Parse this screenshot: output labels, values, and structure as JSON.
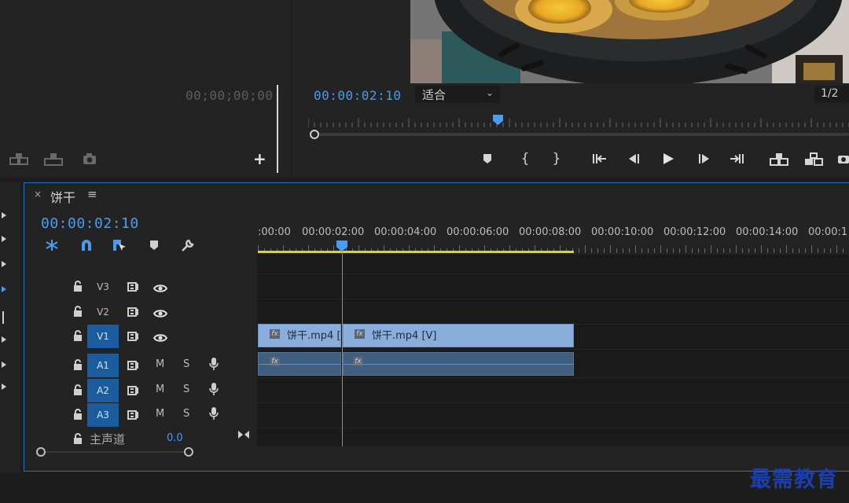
{
  "source_monitor": {
    "timecode": "00;00;00;00",
    "add_icon": "plus-icon"
  },
  "program_monitor": {
    "timecode": "00:00:02:10",
    "zoom": "适合",
    "quality": "1/2",
    "controls": [
      "add-marker-icon",
      "mark-in-icon",
      "mark-out-icon",
      "go-to-in-icon",
      "step-back-icon",
      "play-icon",
      "step-forward-icon",
      "go-to-out-icon",
      "lift-icon",
      "extract-icon",
      "export-frame-icon"
    ]
  },
  "sequence": {
    "close": "×",
    "name": "饼干",
    "menu": "≡",
    "timecode": "00:00:02:10",
    "ruler_labels": [
      ":00:00",
      "00:00:02:00",
      "00:00:04:00",
      "00:00:06:00",
      "00:00:08:00",
      "00:00:10:00",
      "00:00:12:00",
      "00:00:14:00",
      "00:00:1"
    ]
  },
  "tracks": {
    "video": [
      {
        "label": "V3",
        "active": false
      },
      {
        "label": "V2",
        "active": false
      },
      {
        "label": "V1",
        "active": true
      }
    ],
    "audio": [
      {
        "label": "A1",
        "mute": "M",
        "solo": "S"
      },
      {
        "label": "A2",
        "mute": "M",
        "solo": "S"
      },
      {
        "label": "A3",
        "mute": "M",
        "solo": "S"
      }
    ],
    "master": {
      "label": "主声道",
      "value": "0.0"
    }
  },
  "clips": {
    "video": [
      {
        "name": "饼干.mp4 ["
      },
      {
        "name": "饼干.mp4 [V]"
      }
    ],
    "fx_badge": "fx"
  },
  "watermark": "最需教育",
  "colors": {
    "accent_blue": "#4a9cf0",
    "video_clip": "#8aaedb",
    "audio_clip": "#3f5e80",
    "work_area": "#d9d23a",
    "active_track": "#1b5c9e"
  }
}
